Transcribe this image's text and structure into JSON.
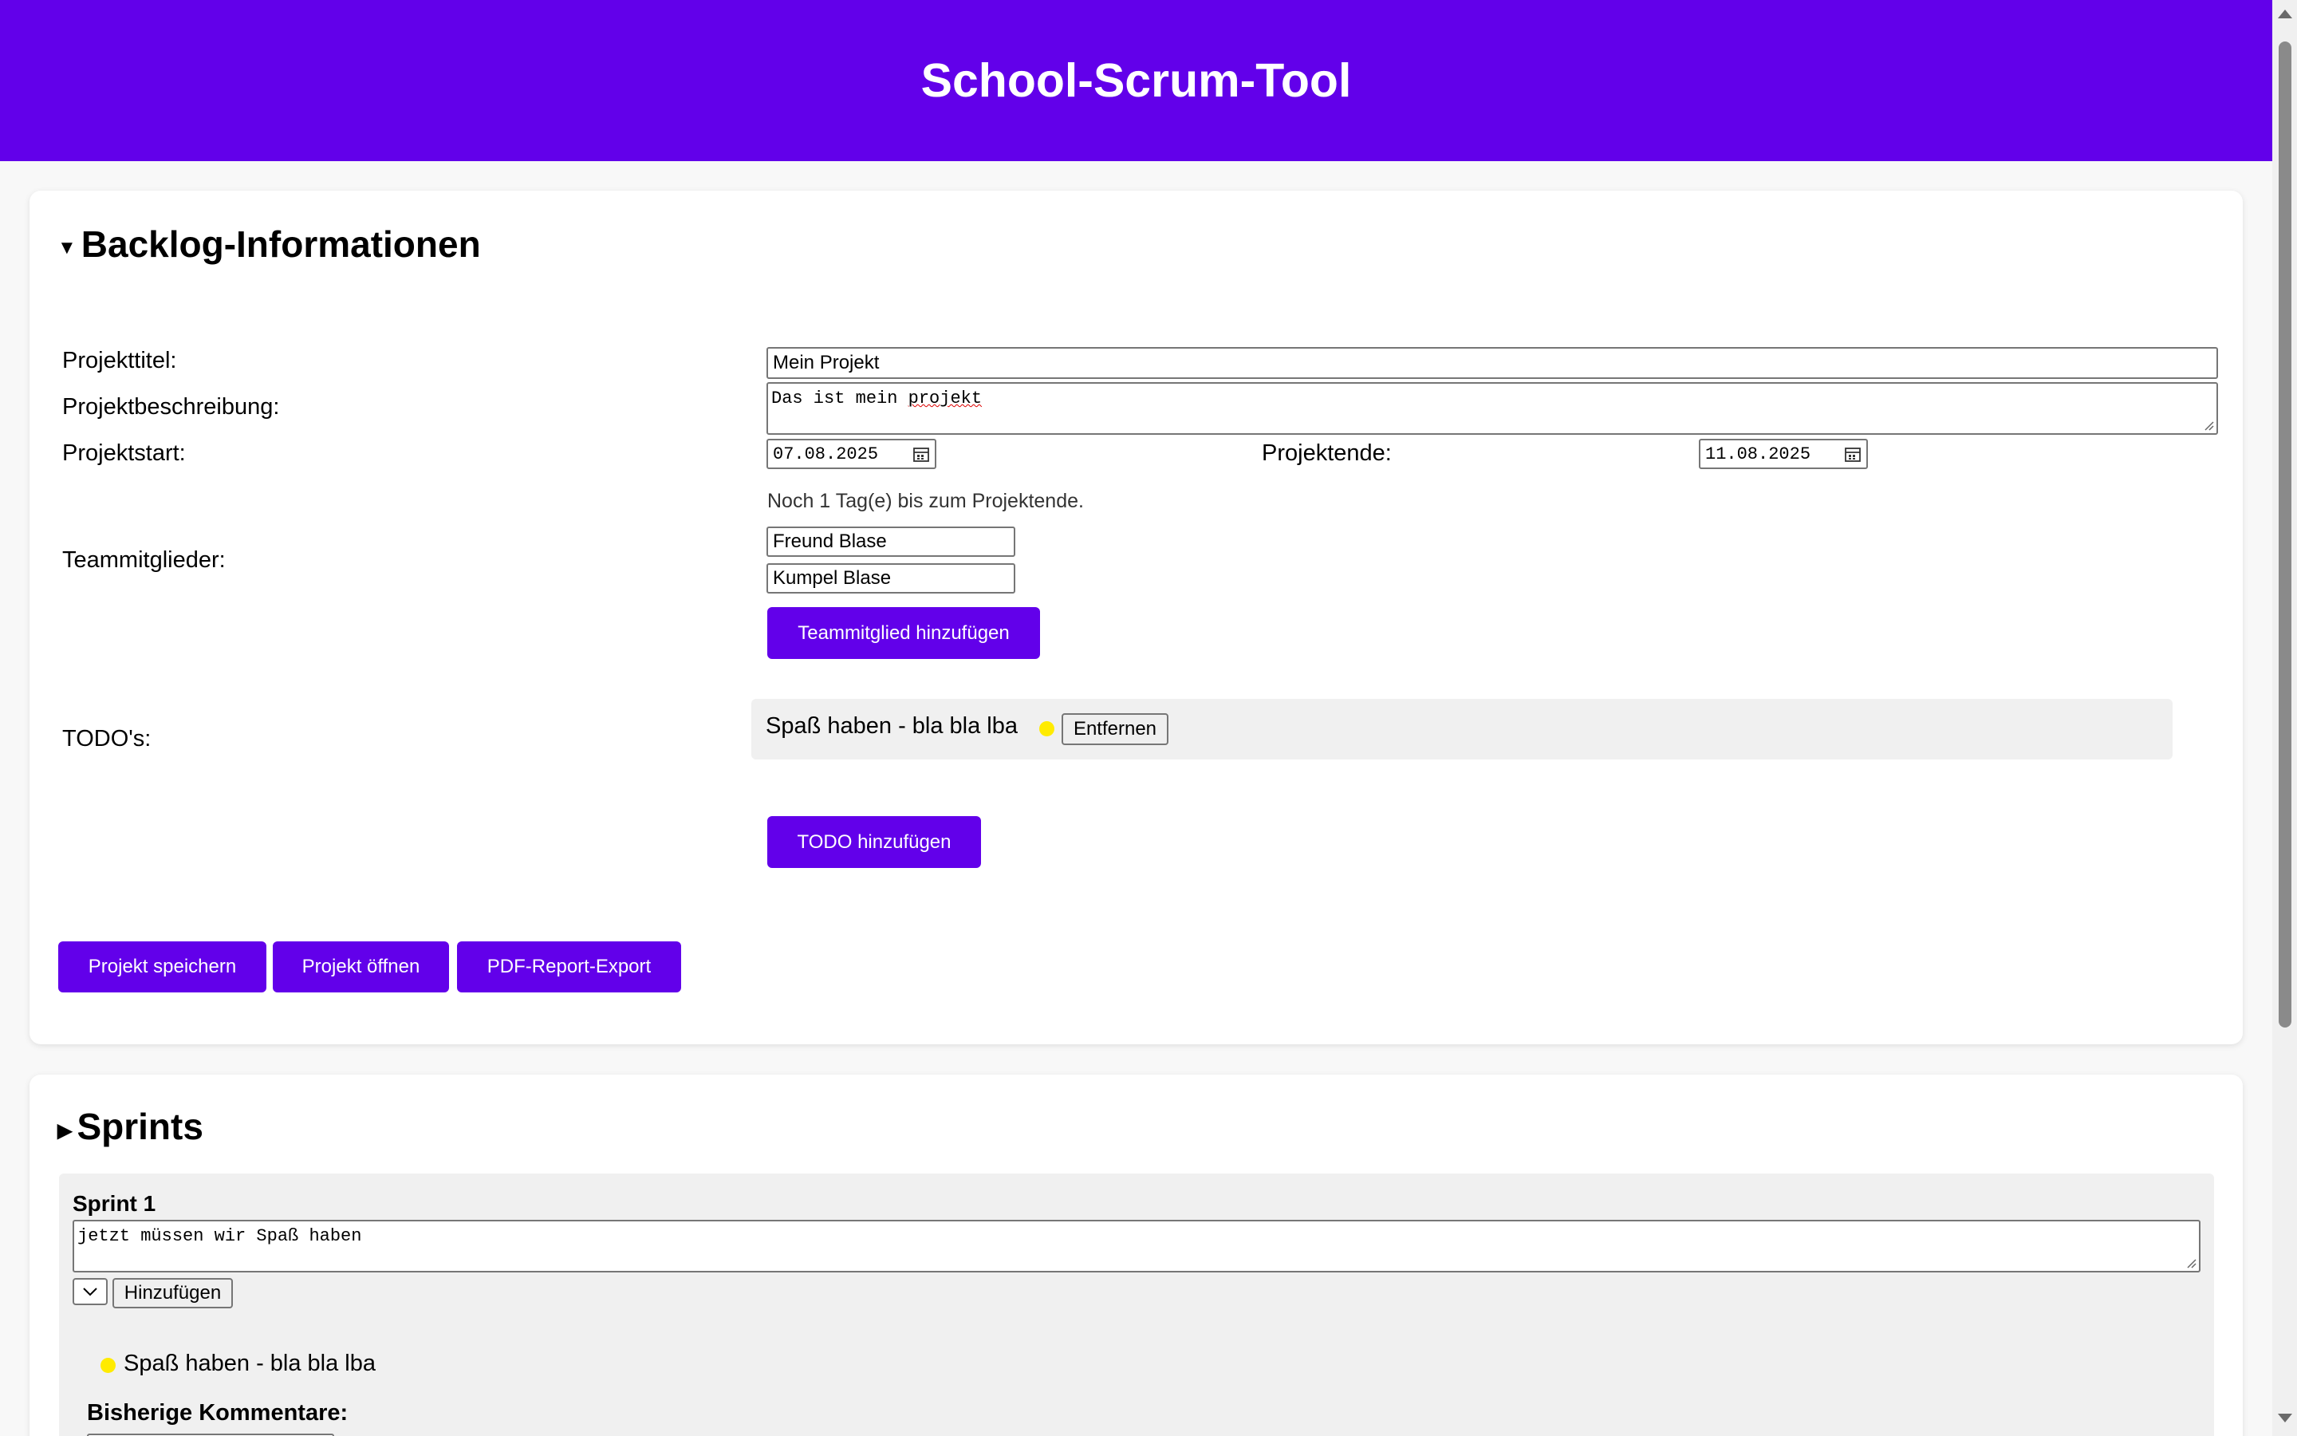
{
  "app": {
    "title": "School-Scrum-Tool"
  },
  "backlog": {
    "section_title": "Backlog-Informationen",
    "labels": {
      "title": "Projekttitel:",
      "description": "Projektbeschreibung:",
      "start": "Projektstart:",
      "end": "Projektende:",
      "team": "Teammitglieder:",
      "todos": "TODO's:"
    },
    "title_value": "Mein Projekt",
    "description_before": "Das ist mein ",
    "description_misspelled": "projekt",
    "start_date": "07.08.2025",
    "end_date": "11.08.2025",
    "days_remaining_text": "Noch 1 Tag(e) bis zum Projektende.",
    "team_members": [
      "Freund Blase",
      "Kumpel Blase"
    ],
    "add_member_label": "Teammitglied hinzufügen",
    "todos": [
      {
        "text": "Spaß haben - bla bla lba",
        "remove_label": "Entfernen",
        "status_color": "#ffeb00"
      }
    ],
    "add_todo_label": "TODO hinzufügen",
    "actions": {
      "save": "Projekt speichern",
      "open": "Projekt öffnen",
      "export": "PDF-Report-Export"
    }
  },
  "sprints": {
    "section_title": "Sprints",
    "items": [
      {
        "name": "Sprint 1",
        "description": "jetzt müssen wir Spaß haben",
        "add_label": "Hinzufügen",
        "todos": [
          {
            "text": "Spaß haben - bla bla lba",
            "status_color": "#ffeb00"
          }
        ],
        "comments_heading": "Bisherige Kommentare:"
      }
    ]
  },
  "colors": {
    "accent": "#6200ea",
    "status_yellow": "#ffeb00"
  },
  "icons": {
    "collapse_open": "triangle-down-icon",
    "collapse_closed": "triangle-right-icon",
    "calendar": "calendar-icon"
  }
}
